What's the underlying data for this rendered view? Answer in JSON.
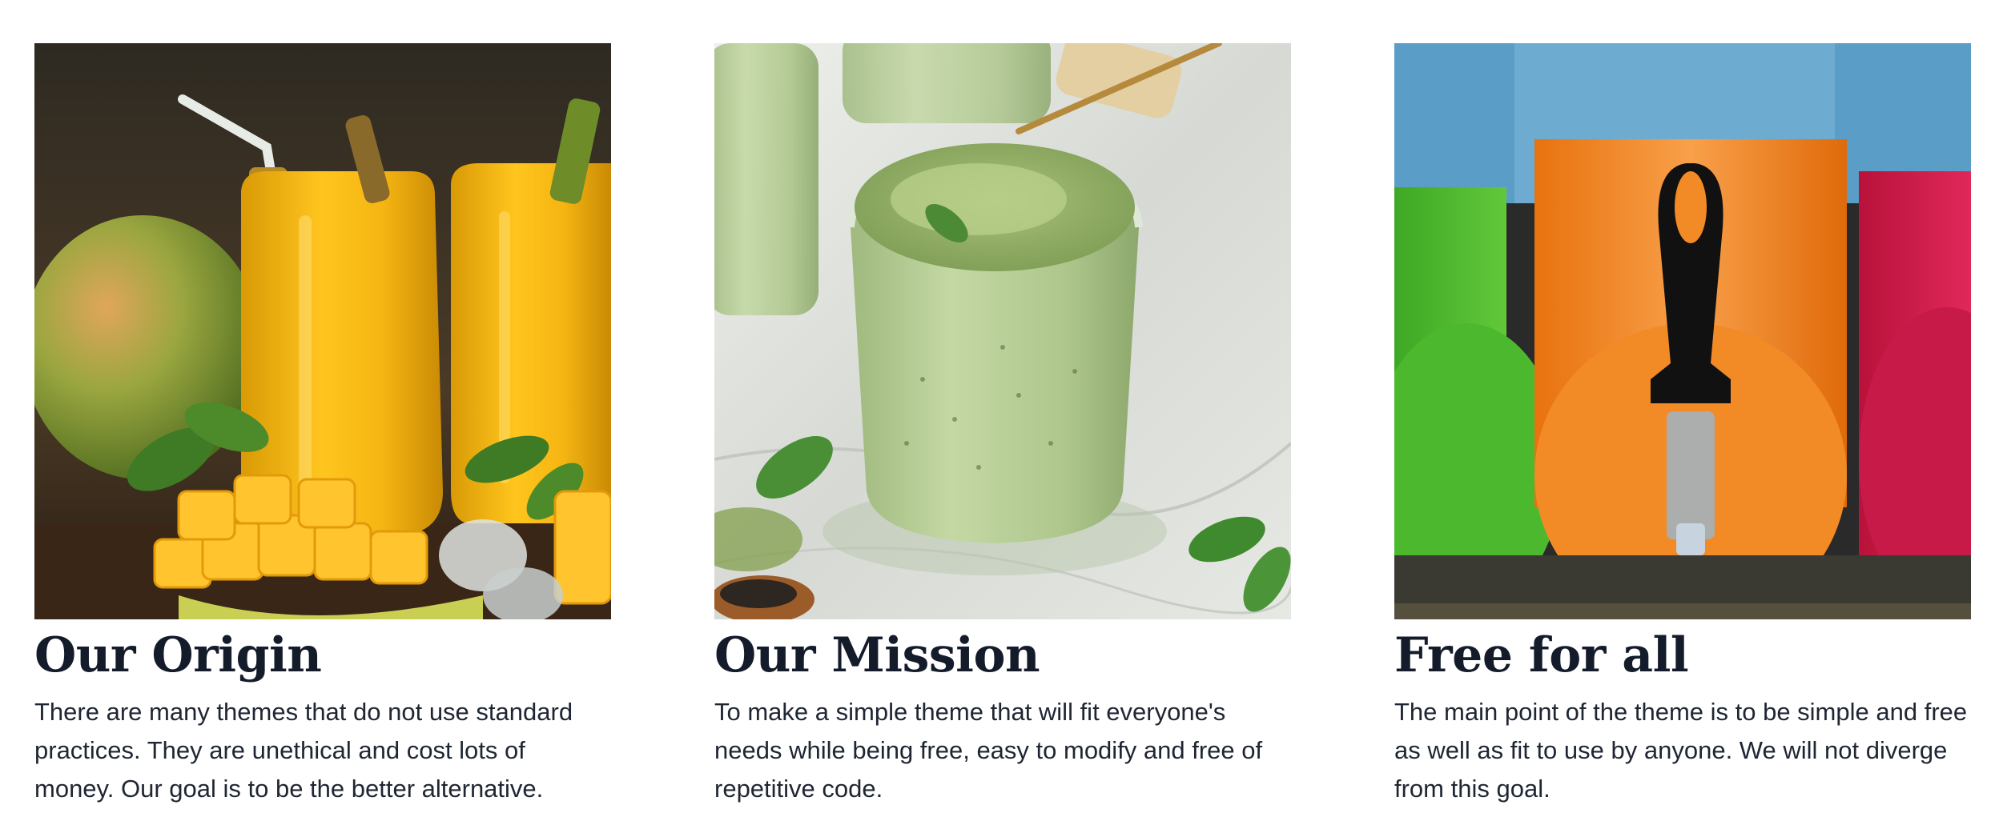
{
  "features": [
    {
      "image_subject": "mango-juice-photo",
      "title": "Our Origin",
      "text": "There are many themes that do not use standard practices. They are unethical and cost lots of money. Our goal is to be the better alternative."
    },
    {
      "image_subject": "matcha-pudding-photo",
      "title": "Our Mission",
      "text": "To make a simple theme that will fit everyone's needs while being free, easy to modify and free of repetitive code."
    },
    {
      "image_subject": "slush-machine-photo",
      "title": "Free for all",
      "text": "The main point of the theme is to be simple and free as well as fit to use by anyone. We will not diverge from this goal."
    }
  ],
  "colors": {
    "heading": "#141b2b",
    "body_text": "#1f2633",
    "background": "#ffffff"
  }
}
